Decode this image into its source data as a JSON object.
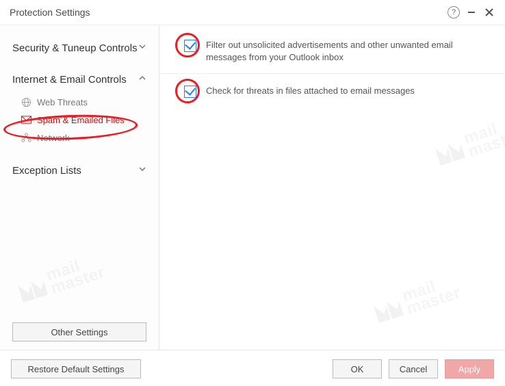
{
  "title": "Protection Settings",
  "sidebar": {
    "groups": [
      {
        "label": "Security & Tuneup Controls",
        "expanded": false
      },
      {
        "label": "Internet & Email Controls",
        "expanded": true,
        "items": [
          {
            "label": "Web Threats",
            "icon": "globe-icon",
            "active": false
          },
          {
            "label": "Spam & Emailed Files",
            "icon": "mail-icon",
            "active": true
          },
          {
            "label": "Network",
            "icon": "network-icon",
            "active": false
          }
        ]
      },
      {
        "label": "Exception Lists",
        "expanded": false
      }
    ],
    "other_settings_label": "Other Settings"
  },
  "options": [
    {
      "checked": true,
      "text": "Filter out unsolicited advertisements and other unwanted email messages from your Outlook inbox"
    },
    {
      "checked": true,
      "text": "Check for threats in files attached to email messages"
    }
  ],
  "footer": {
    "restore": "Restore Default Settings",
    "ok": "OK",
    "cancel": "Cancel",
    "apply": "Apply"
  },
  "watermark": {
    "line1": "mail",
    "line2": "master"
  }
}
